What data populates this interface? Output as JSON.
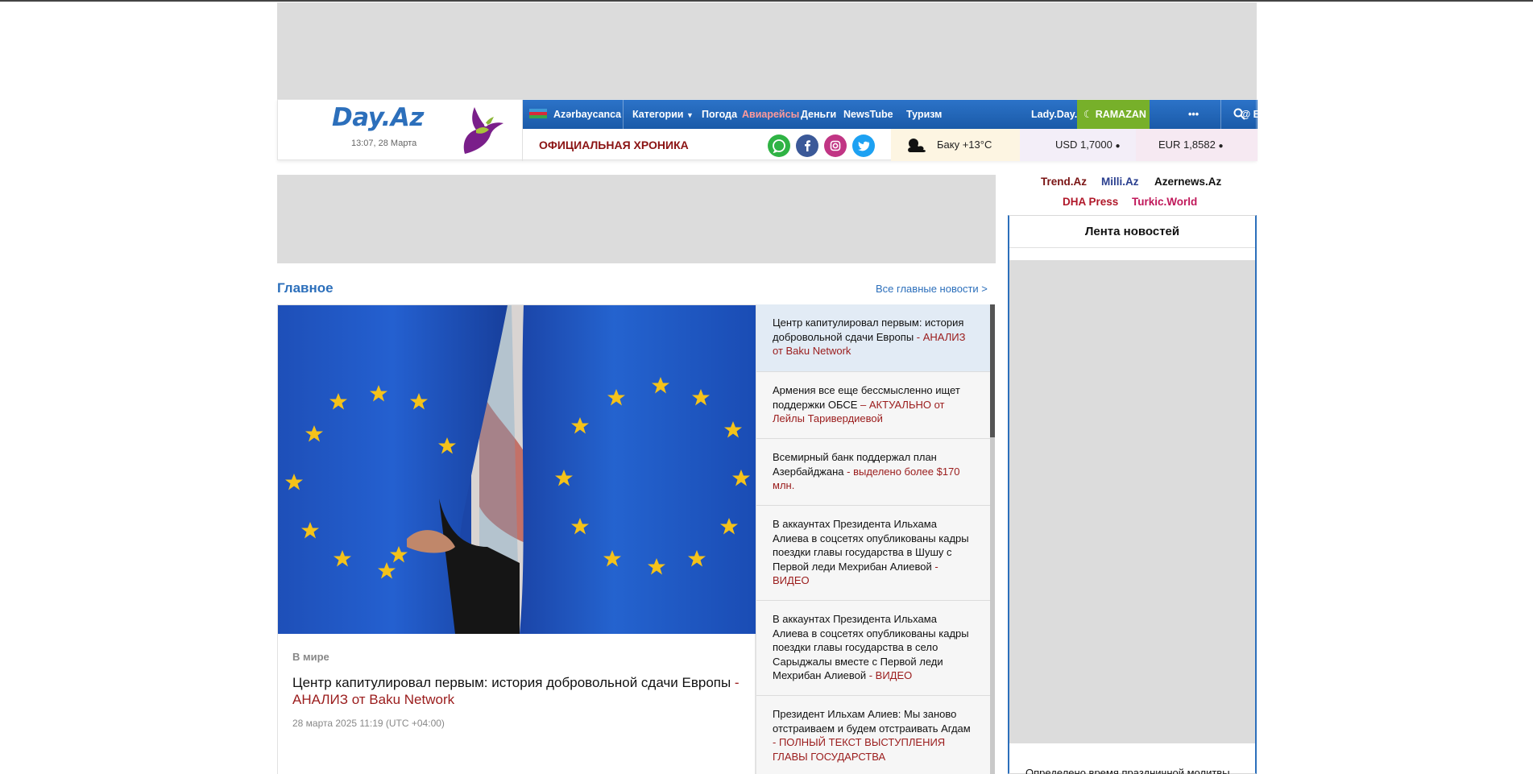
{
  "header": {
    "logo": "Day.Az",
    "datetime": "13:07, 28 Марта",
    "nav": {
      "lang": "Azərbaycanca",
      "categories": "Категории",
      "weather": "Погода",
      "flights": "Авиарейсы",
      "money": "Деньги",
      "newstube": "NewsTube",
      "tourism": "Туризм",
      "lady": "Lady.Day.Az",
      "ramazan": "RAMAZAN",
      "more": "•••",
      "login": "@ Вход"
    },
    "chronicle": "ОФИЦИАЛЬНАЯ ХРОНИКА",
    "weather_text": "Баку +13°C",
    "usd": "USD 1,7000",
    "eur": "EUR 1,8582"
  },
  "colors": {
    "brand_blue": "#2c6fbb",
    "accent_red": "#9a1b1b",
    "ramazan_green": "#77b02a"
  },
  "main": {
    "section_title": "Главное",
    "all_link": "Все главные новости >",
    "feature": {
      "category": "В мире",
      "title": "Центр капитулировал первым: история добровольной сдачи Европы",
      "title_suffix": " - АНАЛИЗ от Baku Network",
      "date": "28 марта 2025 11:19 (UTC +04:00)"
    },
    "items": [
      {
        "text": "Центр капитулировал первым: история добровольной сдачи Европы",
        "suffix": " - АНАЛИЗ от Baku Network"
      },
      {
        "text": "Армения все еще бессмысленно ищет поддержки ОБСЕ",
        "suffix": " – АКТУАЛЬНО от Лейлы Таривердиевой"
      },
      {
        "text": "Всемирный банк поддержал план Азербайджана",
        "suffix": " - выделено более $170 млн."
      },
      {
        "text": "В аккаунтах Президента Ильхама Алиева в соцсетях опубликованы кадры поездки главы государства в Шушу с Первой леди Мехрибан Алиевой",
        "suffix": " - ВИДЕО"
      },
      {
        "text": "В аккаунтах Президента Ильхама Алиева в соцсетях опубликованы кадры поездки главы государства в село Сарыджалы вместе с Первой леди Мехрибан Алиевой",
        "suffix": " - ВИДЕО"
      },
      {
        "text": "Президент Ильхам Алиев: Мы заново отстраиваем и будем отстраивать Агдам",
        "suffix": " - ПОЛНЫЙ ТЕКСТ ВЫСТУПЛЕНИЯ ГЛАВЫ ГОСУДАРСТВА"
      }
    ]
  },
  "sidebar": {
    "partners": [
      "Trend.Az",
      "Milli.Az",
      "Azernews.Az",
      "DHA Press",
      "Turkic.World"
    ],
    "feed_title": "Лента новостей",
    "feed_first": "Определено время праздничной молитвы"
  }
}
